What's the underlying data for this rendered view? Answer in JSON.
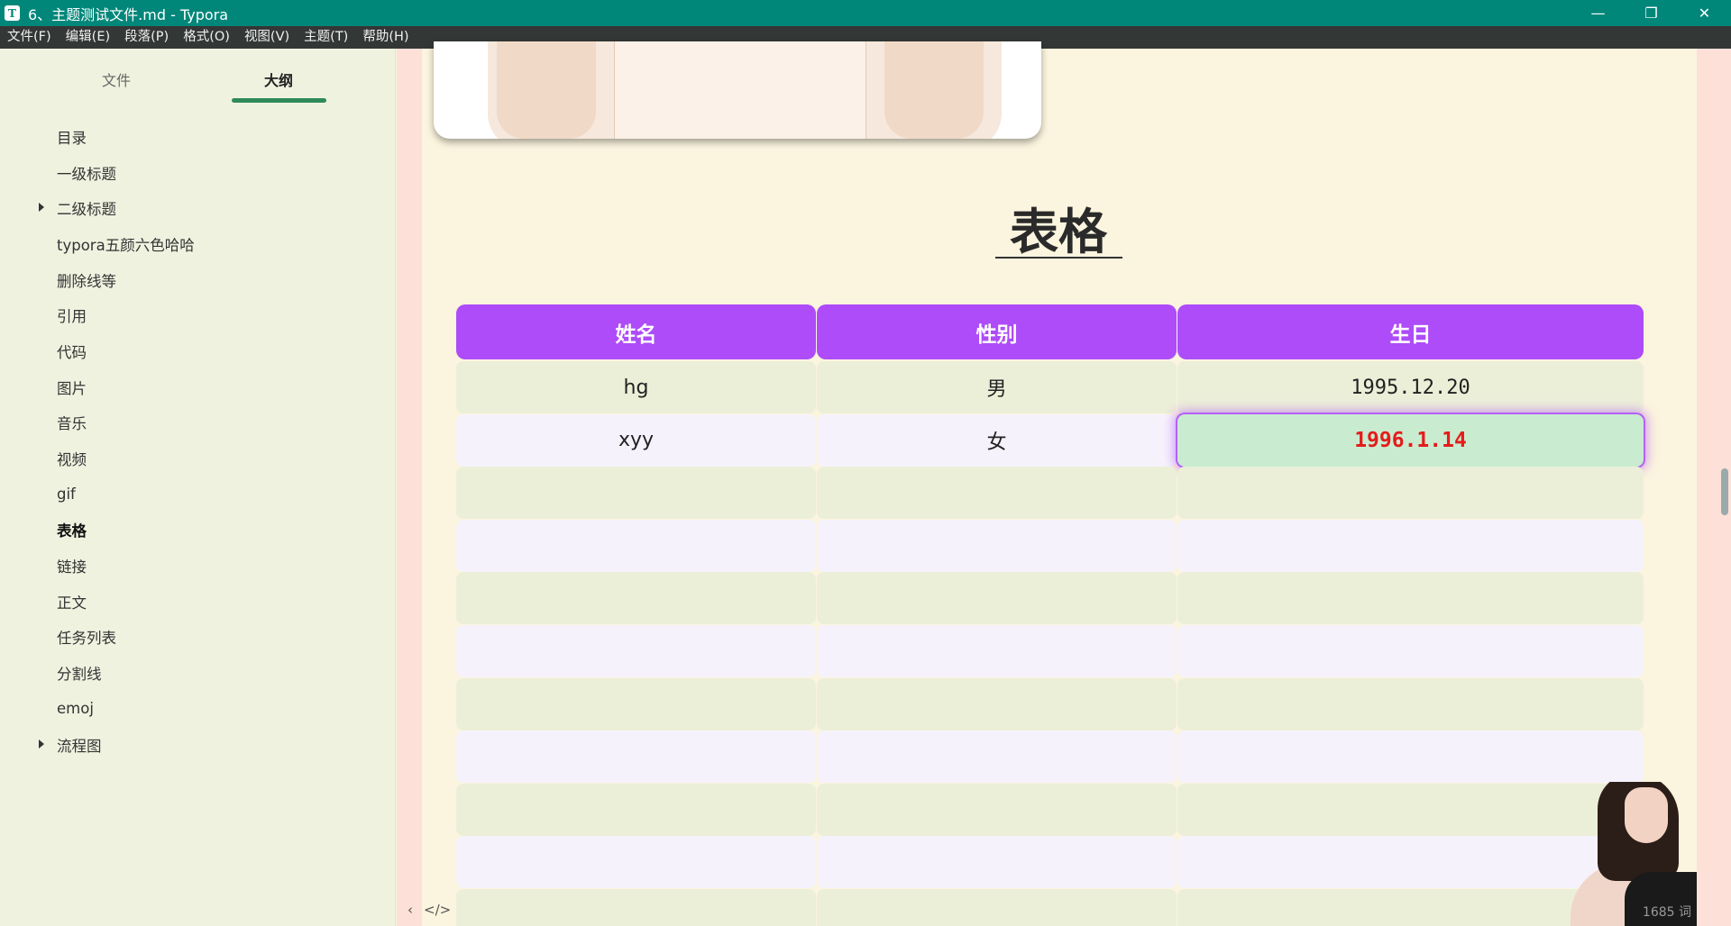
{
  "window": {
    "title": "6、主题测试文件.md - Typora",
    "app_icon": "T",
    "minimize": "—",
    "maximize": "❐",
    "close": "✕"
  },
  "menu": [
    "文件(F)",
    "编辑(E)",
    "段落(P)",
    "格式(O)",
    "视图(V)",
    "主题(T)",
    "帮助(H)"
  ],
  "sidebar": {
    "tabs": [
      {
        "label": "文件",
        "active": false
      },
      {
        "label": "大纲",
        "active": true
      }
    ],
    "outline": [
      {
        "label": "目录",
        "expandable": false
      },
      {
        "label": "一级标题",
        "expandable": false
      },
      {
        "label": "二级标题",
        "expandable": true
      },
      {
        "label": "typora五颜六色哈哈",
        "expandable": false
      },
      {
        "label": "删除线等",
        "expandable": false
      },
      {
        "label": "引用",
        "expandable": false
      },
      {
        "label": "代码",
        "expandable": false
      },
      {
        "label": "图片",
        "expandable": false
      },
      {
        "label": "音乐",
        "expandable": false
      },
      {
        "label": "视频",
        "expandable": false
      },
      {
        "label": "gif",
        "expandable": false
      },
      {
        "label": "表格",
        "expandable": false,
        "active": true
      },
      {
        "label": "链接",
        "expandable": false
      },
      {
        "label": "正文",
        "expandable": false
      },
      {
        "label": "任务列表",
        "expandable": false
      },
      {
        "label": "分割线",
        "expandable": false
      },
      {
        "label": "emoj",
        "expandable": false
      },
      {
        "label": "流程图",
        "expandable": true
      }
    ],
    "footer_left": "‹",
    "footer_code": "</>"
  },
  "document": {
    "heading": "表格",
    "table": {
      "headers": [
        "姓名",
        "性别",
        "生日"
      ],
      "rows": [
        [
          "hg",
          "男",
          "1995.12.20"
        ],
        [
          "xyy",
          "女",
          "1996.1.14"
        ],
        [
          "",
          "",
          ""
        ],
        [
          "",
          "",
          ""
        ],
        [
          "",
          "",
          ""
        ],
        [
          "",
          "",
          ""
        ],
        [
          "",
          "",
          ""
        ],
        [
          "",
          "",
          ""
        ],
        [
          "",
          "",
          ""
        ],
        [
          "",
          "",
          ""
        ],
        [
          "",
          "",
          ""
        ]
      ]
    },
    "word_count": "1685 词"
  },
  "colors": {
    "titlebar": "#01877a",
    "menubar": "#333735",
    "table_header": "#ad4cf8",
    "selected_cell_text": "#e51b1b"
  }
}
